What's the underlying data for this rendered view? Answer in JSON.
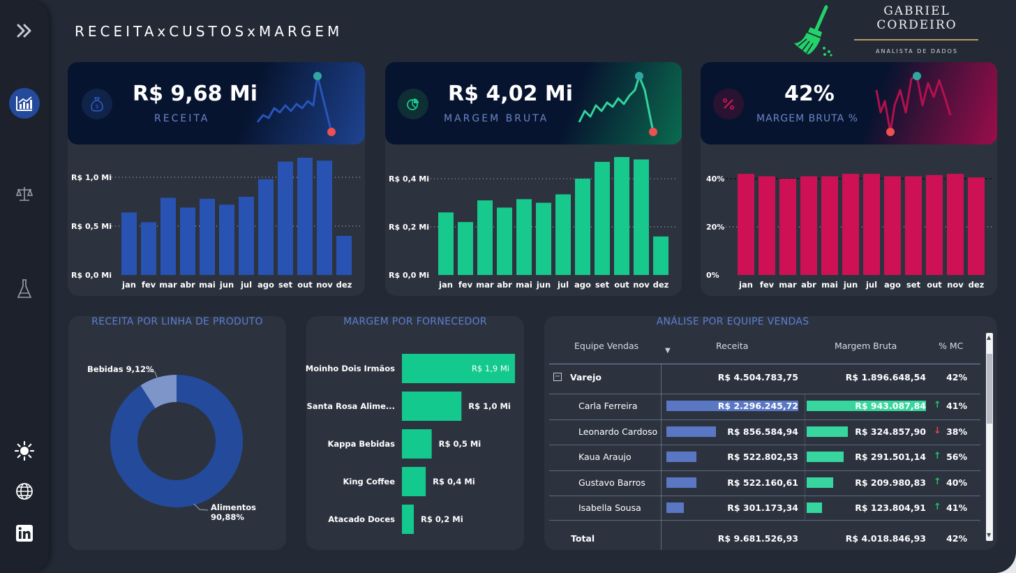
{
  "header": {
    "title": "RECEITAxCUSTOSxMARGEM"
  },
  "logo": {
    "name_line1": "GABRIEL",
    "name_line2": "CORDEIRO",
    "subtitle": "ANALISTA DE DADOS",
    "icon": "broom-icon"
  },
  "sidebar": {
    "icons": [
      "expand-icon",
      "chart-icon",
      "scale-icon",
      "flask-icon",
      "sun-icon",
      "globe-icon",
      "linkedin-icon"
    ]
  },
  "kpis": [
    {
      "value": "R$ 9,68 Mi",
      "label": "RECEITA",
      "icon": "money-bag-icon",
      "color": "#244a9c",
      "label_color": "#6b86c9"
    },
    {
      "value": "R$ 4,02 Mi",
      "label": "MARGEM BRUTA",
      "icon": "pie-icon",
      "color": "#14c98d",
      "label_color": "#6b86c9"
    },
    {
      "value": "42%",
      "label": "MARGEM  BRUTA %",
      "icon": "percent-icon",
      "color": "#cc1155",
      "label_color": "#6b86c9"
    }
  ],
  "chart_data": [
    {
      "type": "bar",
      "categories": [
        "jan",
        "fev",
        "mar",
        "abr",
        "mai",
        "jun",
        "jul",
        "ago",
        "set",
        "out",
        "nov",
        "dez"
      ],
      "values": [
        0.64,
        0.54,
        0.79,
        0.69,
        0.78,
        0.72,
        0.8,
        0.98,
        1.16,
        1.2,
        1.17,
        0.4
      ],
      "yticks": [
        "R$ 0,0 Mi",
        "R$ 0,5 Mi",
        "R$ 1,0 Mi"
      ],
      "ytick_values": [
        0,
        0.5,
        1.0
      ],
      "ylim": [
        0,
        1.2
      ],
      "color": "#244a9c",
      "grid": true
    },
    {
      "type": "bar",
      "categories": [
        "jan",
        "fev",
        "mar",
        "abr",
        "mai",
        "jun",
        "jul",
        "ago",
        "set",
        "out",
        "nov",
        "dez"
      ],
      "values": [
        0.26,
        0.22,
        0.31,
        0.28,
        0.315,
        0.3,
        0.335,
        0.4,
        0.47,
        0.49,
        0.48,
        0.16
      ],
      "yticks": [
        "R$ 0,0 Mi",
        "R$ 0,2 Mi",
        "R$ 0,4 Mi"
      ],
      "ytick_values": [
        0,
        0.2,
        0.4
      ],
      "ylim": [
        0,
        0.49
      ],
      "color": "#14c98d",
      "grid": true
    },
    {
      "type": "bar",
      "categories": [
        "jan",
        "fev",
        "mar",
        "abr",
        "mai",
        "jun",
        "jul",
        "ago",
        "set",
        "out",
        "nov",
        "dez"
      ],
      "values": [
        42,
        41,
        40,
        41,
        41,
        42,
        42,
        41,
        41,
        41.5,
        42,
        40.5
      ],
      "yticks": [
        "0%",
        "20%",
        "40%"
      ],
      "ytick_values": [
        0,
        20,
        40
      ],
      "ylim": [
        0,
        40
      ],
      "color": "#cc1155",
      "grid": true
    },
    {
      "type": "pie",
      "title": "RECEITA POR LINHA DE PRODUTO",
      "labels": [
        "Alimentos",
        "Bebidas"
      ],
      "values": [
        90.88,
        9.12
      ],
      "data_labels": [
        "Alimentos\n90,88%",
        "Bebidas 9,12%"
      ],
      "colors": [
        "#244a9c",
        "#7d95c9"
      ]
    },
    {
      "type": "bar",
      "orientation": "horizontal",
      "title": "MARGEM POR FORNECEDOR",
      "categories": [
        "Moinho Dois Irmãos",
        "Santa Rosa Alime...",
        "Kappa Bebidas",
        "King Coffee",
        "Atacado Doces"
      ],
      "values": [
        1.9,
        1.0,
        0.5,
        0.4,
        0.2
      ],
      "data_labels": [
        "R$ 1,9 Mi",
        "R$ 1,0 Mi",
        "R$ 0,5 Mi",
        "R$ 0,4 Mi",
        "R$ 0,2 Mi"
      ],
      "color": "#14c98d"
    },
    {
      "type": "table",
      "title": "ANÁLISE POR EQUIPE VENDAS",
      "columns": [
        "Equipe Vendas",
        "Receita",
        "Margem Bruta",
        "% MC"
      ],
      "group": {
        "name": "Varejo",
        "receita": "R$ 4.504.783,75",
        "margem": "R$ 1.896.648,54",
        "mc": "42%"
      },
      "rows": [
        {
          "name": "Carla Ferreira",
          "receita": "R$ 2.296.245,72",
          "receita_value": 2296245.72,
          "margem": "R$ 943.087,84",
          "margem_value": 943087.84,
          "trend": "up",
          "mc": "41%"
        },
        {
          "name": "Leonardo Cardoso",
          "receita": "R$ 856.584,94",
          "receita_value": 856584.94,
          "margem": "R$ 324.857,90",
          "margem_value": 324857.9,
          "trend": "down",
          "mc": "38%"
        },
        {
          "name": "Kaua Araujo",
          "receita": "R$ 522.802,53",
          "receita_value": 522802.53,
          "margem": "R$ 291.501,14",
          "margem_value": 291501.14,
          "trend": "up",
          "mc": "56%"
        },
        {
          "name": "Gustavo Barros",
          "receita": "R$ 522.160,61",
          "receita_value": 522160.61,
          "margem": "R$ 209.980,83",
          "margem_value": 209980.83,
          "trend": "up",
          "mc": "40%"
        },
        {
          "name": "Isabella Sousa",
          "receita": "R$ 301.173,34",
          "receita_value": 301173.34,
          "margem": "R$ 123.804,91",
          "margem_value": 123804.91,
          "trend": "up",
          "mc": "41%"
        }
      ],
      "total": {
        "name": "Total",
        "receita": "R$ 9.681.526,93",
        "margem": "R$ 4.018.846,93",
        "mc": "42%"
      }
    }
  ],
  "colors": {
    "up": "#22c55e",
    "down": "#ef4444",
    "bg": "#232a36",
    "panel": "#2c333f"
  }
}
